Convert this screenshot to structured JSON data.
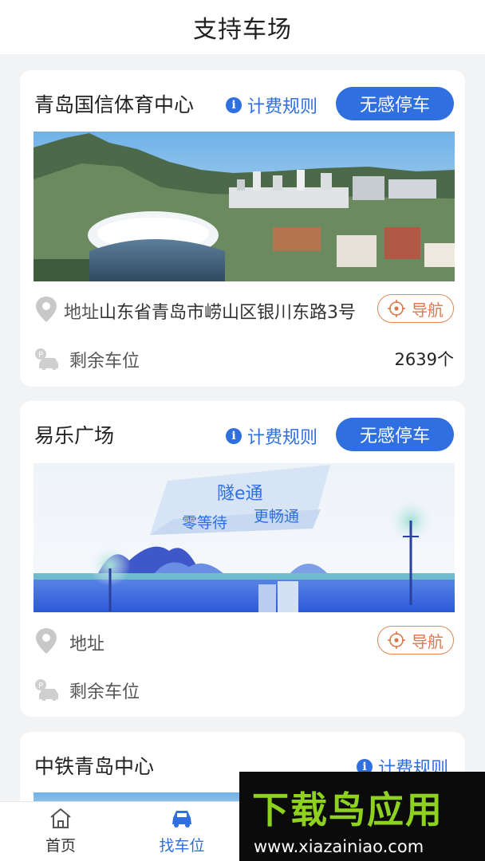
{
  "header": {
    "title": "支持车场"
  },
  "lots": [
    {
      "name": "青岛国信体育中心",
      "rules_label": "计费规则",
      "park_label": "无感停车",
      "address_label": "地址",
      "address_value": "山东省青岛市崂山区银川东路3号",
      "nav_label": "导航",
      "spaces_label": "剩余车位",
      "spaces_value": "2639个"
    },
    {
      "name": "易乐广场",
      "rules_label": "计费规则",
      "park_label": "无感停车",
      "address_label": "地址",
      "nav_label": "导航",
      "spaces_label": "剩余车位",
      "banner": {
        "title": "隧e通",
        "left": "零等待",
        "right": "更畅通"
      }
    },
    {
      "name": "中铁青岛中心",
      "rules_label": "计费规则"
    }
  ],
  "tabbar": {
    "items": [
      {
        "label": "首页",
        "icon": "home-icon",
        "active": false
      },
      {
        "label": "找车位",
        "icon": "car-icon",
        "active": true
      }
    ]
  },
  "watermark": {
    "title": "下载鸟应用",
    "url": "www.xiazainiao.com"
  },
  "colors": {
    "accent": "#2f6fe0",
    "nav": "#d9774a",
    "background": "#f2f3f5"
  }
}
